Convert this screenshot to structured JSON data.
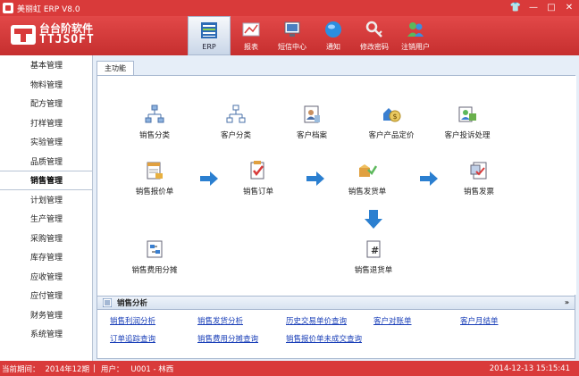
{
  "window": {
    "title": "美丽虹 ERP V8.0",
    "controls": [
      "👕",
      "—",
      "□",
      "✕"
    ]
  },
  "logo": {
    "cn": "台台阶软件",
    "en": "TTJSOFT"
  },
  "toolbar": [
    {
      "label": "ERP",
      "icon": "erp-icon",
      "active": true
    },
    {
      "label": "报表",
      "icon": "report-icon"
    },
    {
      "label": "短信中心",
      "icon": "sms-icon"
    },
    {
      "label": "通知",
      "icon": "notice-icon"
    },
    {
      "label": "修改密码",
      "icon": "key-icon"
    },
    {
      "label": "注销用户",
      "icon": "logout-icon"
    }
  ],
  "sidebar": {
    "items": [
      "基本管理",
      "物料管理",
      "配方管理",
      "打样管理",
      "实验管理",
      "品质管理",
      "销售管理",
      "计划管理",
      "生产管理",
      "采购管理",
      "库存管理",
      "应收管理",
      "应付管理",
      "财务管理",
      "系统管理"
    ],
    "selected": "销售管理"
  },
  "main": {
    "tab": "主功能",
    "functions": [
      {
        "label": "销售分类",
        "icon": "category-tree-icon"
      },
      {
        "label": "客户分类",
        "icon": "customer-tree-icon"
      },
      {
        "label": "客户档案",
        "icon": "customer-file-icon"
      },
      {
        "label": "客户产品定价",
        "icon": "pricing-icon"
      },
      {
        "label": "客户投诉处理",
        "icon": "complaint-icon"
      },
      {
        "label": "销售报价单",
        "icon": "quote-icon"
      },
      {
        "label": "销售订单",
        "icon": "order-icon"
      },
      {
        "label": "销售发货单",
        "icon": "delivery-icon"
      },
      {
        "label": "销售发票",
        "icon": "invoice-icon"
      },
      {
        "label": "销售费用分摊",
        "icon": "expense-icon"
      },
      {
        "label": "销售退货单",
        "icon": "return-icon"
      }
    ]
  },
  "analysis": {
    "title": "销售分析",
    "collapse": "»",
    "links": [
      "销售利润分析",
      "销售发货分析",
      "历史交易单价查询",
      "客户对账单",
      "客户月结单",
      "订单追踪查询",
      "销售费用分摊查询",
      "销售报价单未成交查询"
    ]
  },
  "status": {
    "period_label": "当前期间：",
    "period": "2014年12期",
    "user_label": "用户：",
    "user": "U001 - 林西",
    "datetime": "2014-12-13 15:15:41"
  },
  "colors": {
    "brand": "#d93a3a",
    "panel": "#e6eef8",
    "link": "#1a3fb8",
    "arrow": "#2b7fd0"
  }
}
